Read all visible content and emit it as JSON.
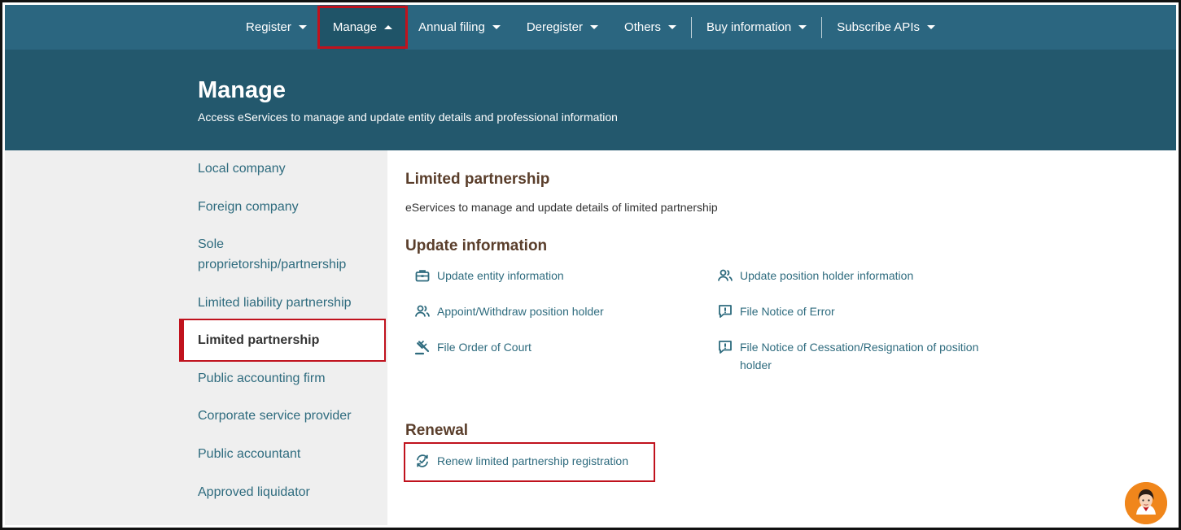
{
  "nav": {
    "items": [
      {
        "label": "Register"
      },
      {
        "label": "Manage"
      },
      {
        "label": "Annual filing"
      },
      {
        "label": "Deregister"
      },
      {
        "label": "Others"
      },
      {
        "label": "Buy information"
      },
      {
        "label": "Subscribe APIs"
      }
    ]
  },
  "hero": {
    "title": "Manage",
    "subtitle": "Access eServices to manage and update entity details and professional information"
  },
  "sidebar": {
    "items": [
      {
        "label": "Local company"
      },
      {
        "label": "Foreign company"
      },
      {
        "label": "Sole proprietorship/partnership"
      },
      {
        "label": "Limited liability partnership"
      },
      {
        "label": "Limited partnership",
        "active": true
      },
      {
        "label": "Public accounting firm"
      },
      {
        "label": "Corporate service provider"
      },
      {
        "label": "Public accountant"
      },
      {
        "label": "Approved liquidator"
      }
    ]
  },
  "main": {
    "title": "Limited partnership",
    "description": "eServices to manage and update details of limited partnership",
    "update": {
      "title": "Update information",
      "services": [
        {
          "label": "Update entity information",
          "icon": "briefcase-icon"
        },
        {
          "label": "Update position holder information",
          "icon": "users-icon"
        },
        {
          "label": "Appoint/Withdraw position holder",
          "icon": "users-icon"
        },
        {
          "label": "File Notice of Error",
          "icon": "alert-message-icon"
        },
        {
          "label": "File Order of Court",
          "icon": "gavel-icon"
        },
        {
          "label": "File Notice of Cessation/Resignation of position holder",
          "icon": "alert-message-icon"
        }
      ]
    },
    "renewal": {
      "title": "Renewal",
      "services": [
        {
          "label": "Renew limited partnership registration",
          "icon": "renew-icon"
        }
      ]
    }
  },
  "colors": {
    "nav_bg": "#2b6680",
    "hero_bg": "#23586d",
    "link": "#2e6b7e",
    "heading": "#5a3e2b",
    "highlight": "#c0121d",
    "sidebar_bg": "#efefef"
  }
}
